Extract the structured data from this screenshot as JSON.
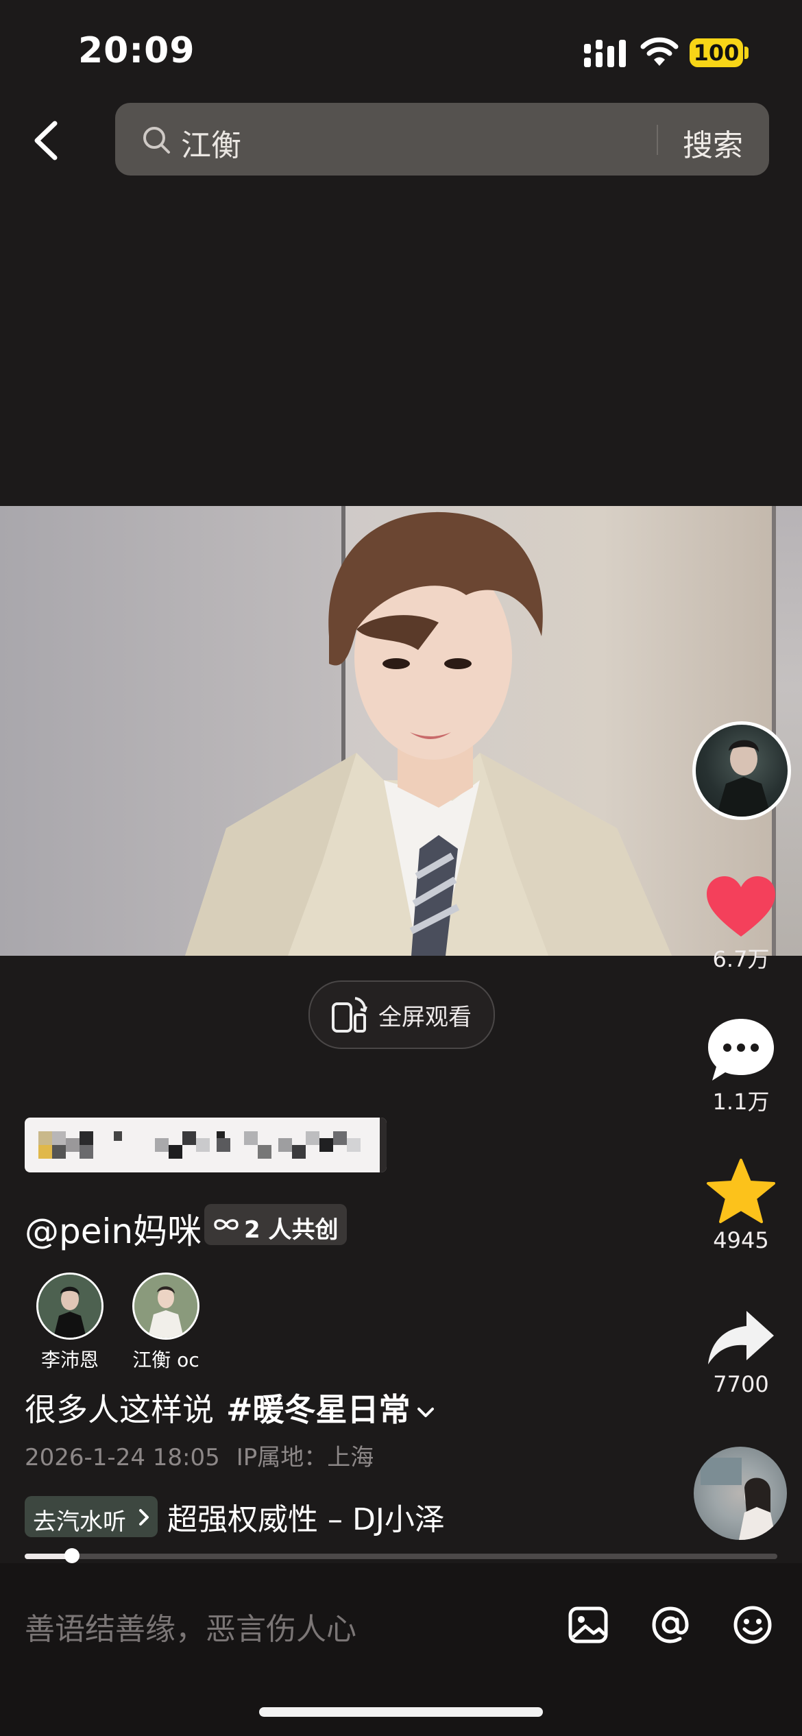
{
  "status_bar": {
    "time": "20:09",
    "battery": "100"
  },
  "search": {
    "query": "江衡",
    "button": "搜索"
  },
  "video": {
    "fullscreen_label": "全屏观看",
    "progress": 0.063
  },
  "actions": {
    "likes": "6.7万",
    "comments": "1.1万",
    "favorites": "4945",
    "shares": "7700"
  },
  "post": {
    "author": "@pein妈咪",
    "cocreate": "2 人共创",
    "creators": [
      {
        "name": "李沛恩"
      },
      {
        "name": "江衡 oc"
      }
    ],
    "caption": "很多人这样说",
    "hashtag": "#暖冬星日常",
    "date": "2026-1-24 18:05",
    "ip": "IP属地：上海"
  },
  "music": {
    "badge": "去汽水听",
    "title": "超强权威性 – DJ小泽"
  },
  "comment_bar": {
    "placeholder": "善语结善缘，恶言伤人心"
  },
  "colors": {
    "like": "#f4405b",
    "favorite": "#fcc21b",
    "background": "#1c1a1a"
  }
}
